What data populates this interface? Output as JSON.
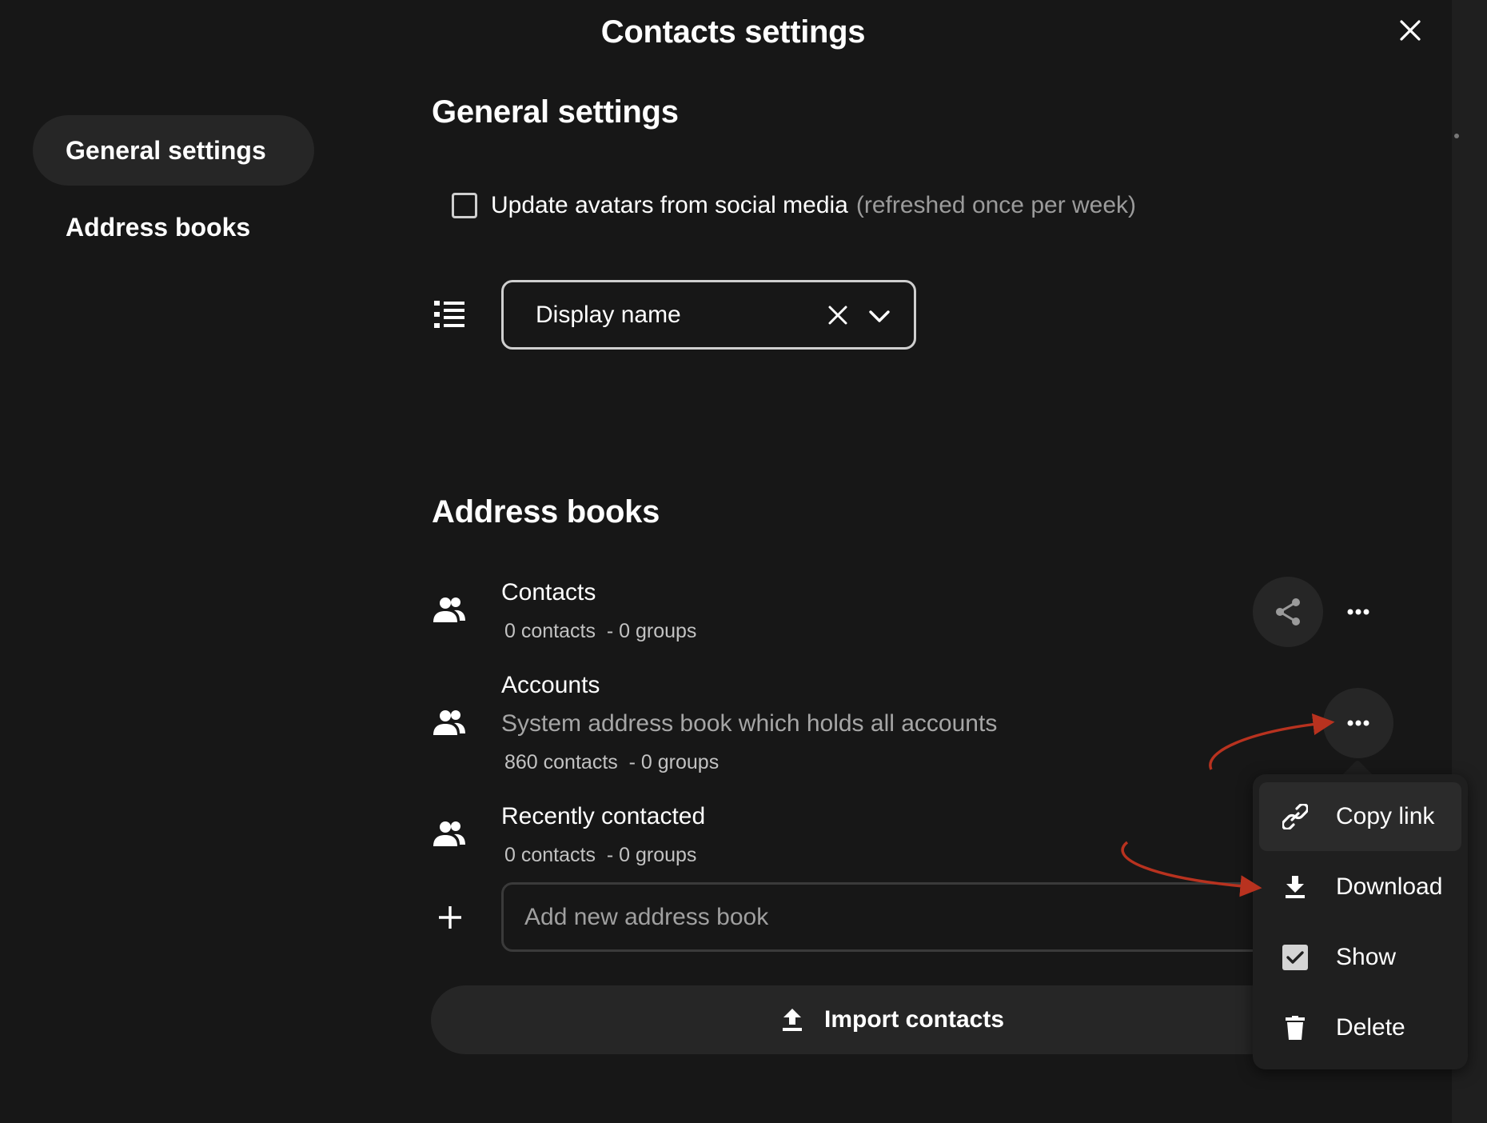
{
  "modal": {
    "title": "Contacts settings"
  },
  "sidebar": {
    "items": [
      {
        "label": "General settings",
        "active": true
      },
      {
        "label": "Address books",
        "active": false
      }
    ]
  },
  "general": {
    "title": "General settings",
    "avatar_option": {
      "label": "Update avatars from social media",
      "hint": "(refreshed once per week)",
      "checked": false
    },
    "sort": {
      "value": "Display name"
    }
  },
  "address_books": {
    "title": "Address books",
    "list": [
      {
        "name": "Contacts",
        "description": "",
        "counts": "0 contacts  - 0 groups"
      },
      {
        "name": "Accounts",
        "description": "System address book which holds all accounts",
        "counts": "860 contacts  - 0 groups"
      },
      {
        "name": "Recently contacted",
        "description": "",
        "counts": "0 contacts  - 0 groups"
      }
    ],
    "add_placeholder": "Add new address book",
    "import_label": "Import contacts"
  },
  "menu": {
    "items": [
      {
        "label": "Copy link",
        "icon": "link-icon"
      },
      {
        "label": "Download",
        "icon": "download-icon"
      },
      {
        "label": "Show",
        "icon": "checkbox-checked-icon",
        "checked": true
      },
      {
        "label": "Delete",
        "icon": "trash-icon"
      }
    ]
  },
  "colors": {
    "background": "#171717",
    "surface": "#262626",
    "popover": "#1f1f1f",
    "annotation_arrow": "#b8321f"
  }
}
